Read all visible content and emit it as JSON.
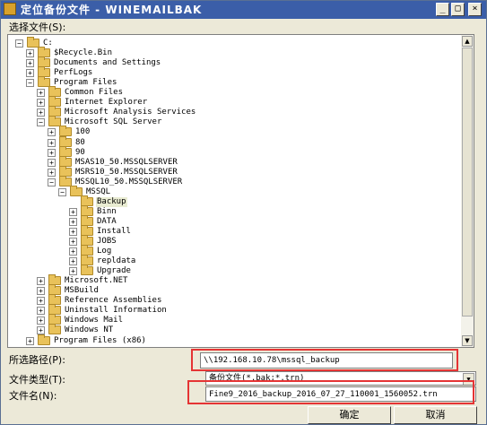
{
  "window": {
    "title": "定位备份文件 - WINEMAILBAK",
    "controls": {
      "minimize": "_",
      "maximize": "□",
      "close": "×"
    }
  },
  "select_file_label": "选择文件(S):",
  "tree": {
    "nodes": [
      {
        "name": "C:",
        "level": 0,
        "expander": "−"
      },
      {
        "name": "$Recycle.Bin",
        "level": 1,
        "expander": "+"
      },
      {
        "name": "Documents and Settings",
        "level": 1,
        "expander": "+"
      },
      {
        "name": "PerfLogs",
        "level": 1,
        "expander": "+"
      },
      {
        "name": "Program Files",
        "level": 1,
        "expander": "−"
      },
      {
        "name": "Common Files",
        "level": 2,
        "expander": "+"
      },
      {
        "name": "Internet Explorer",
        "level": 2,
        "expander": "+"
      },
      {
        "name": "Microsoft Analysis Services",
        "level": 2,
        "expander": "+"
      },
      {
        "name": "Microsoft SQL Server",
        "level": 2,
        "expander": "−"
      },
      {
        "name": "100",
        "level": 3,
        "expander": "+"
      },
      {
        "name": "80",
        "level": 3,
        "expander": "+"
      },
      {
        "name": "90",
        "level": 3,
        "expander": "+"
      },
      {
        "name": "MSAS10_50.MSSQLSERVER",
        "level": 3,
        "expander": "+"
      },
      {
        "name": "MSRS10_50.MSSQLSERVER",
        "level": 3,
        "expander": "+"
      },
      {
        "name": "MSSQL10_50.MSSQLSERVER",
        "level": 3,
        "expander": "−"
      },
      {
        "name": "MSSQL",
        "level": 4,
        "expander": "−"
      },
      {
        "name": "Backup",
        "level": 5,
        "expander": "",
        "selected": true
      },
      {
        "name": "Binn",
        "level": 5,
        "expander": "+"
      },
      {
        "name": "DATA",
        "level": 5,
        "expander": "+"
      },
      {
        "name": "Install",
        "level": 5,
        "expander": "+"
      },
      {
        "name": "JOBS",
        "level": 5,
        "expander": "+"
      },
      {
        "name": "Log",
        "level": 5,
        "expander": "+"
      },
      {
        "name": "repldata",
        "level": 5,
        "expander": "+"
      },
      {
        "name": "Upgrade",
        "level": 5,
        "expander": "+"
      },
      {
        "name": "Microsoft.NET",
        "level": 2,
        "expander": "+"
      },
      {
        "name": "MSBuild",
        "level": 2,
        "expander": "+"
      },
      {
        "name": "Reference Assemblies",
        "level": 2,
        "expander": "+"
      },
      {
        "name": "Uninstall Information",
        "level": 2,
        "expander": "+"
      },
      {
        "name": "Windows Mail",
        "level": 2,
        "expander": "+"
      },
      {
        "name": "Windows NT",
        "level": 2,
        "expander": "+"
      },
      {
        "name": "Program Files (x86)",
        "level": 1,
        "expander": "+"
      }
    ]
  },
  "selected_path": {
    "label": "所选路径(P):",
    "value": "\\\\192.168.10.78\\mssql_backup"
  },
  "file_type": {
    "label": "文件类型(T):",
    "value": "备份文件(*.bak;*.trn)"
  },
  "file_name": {
    "label": "文件名(N):",
    "value": "Fine9_2016_backup_2016_07_27_110001_1560052.trn"
  },
  "buttons": {
    "ok": "确定",
    "cancel": "取消"
  },
  "colors": {
    "highlight": "#e53434",
    "titlebar": "#3b5ea8",
    "selection": "#e9ecd2"
  }
}
